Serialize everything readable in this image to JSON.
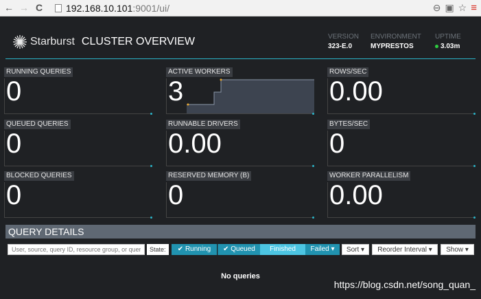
{
  "browser": {
    "back": "←",
    "forward": "→",
    "reload": "C",
    "url_host": "192.168.10.101",
    "url_rest": ":9001/ui/"
  },
  "header": {
    "logo_text": "Starburst",
    "title": "CLUSTER OVERVIEW",
    "version_label": "VERSION",
    "version_value": "323-E.0",
    "environment_label": "ENVIRONMENT",
    "environment_value": "MYPRESTOS",
    "uptime_label": "UPTIME",
    "uptime_value": "3.03m"
  },
  "cards": {
    "running_queries": {
      "label": "RUNNING QUERIES",
      "value": "0"
    },
    "active_workers": {
      "label": "ACTIVE WORKERS",
      "value": "3"
    },
    "rows_sec": {
      "label": "ROWS/SEC",
      "value": "0.00"
    },
    "queued_queries": {
      "label": "QUEUED QUERIES",
      "value": "0"
    },
    "runnable_drivers": {
      "label": "RUNNABLE DRIVERS",
      "value": "0.00"
    },
    "bytes_sec": {
      "label": "BYTES/SEC",
      "value": "0"
    },
    "blocked_queries": {
      "label": "BLOCKED QUERIES",
      "value": "0"
    },
    "reserved_memory": {
      "label": "RESERVED MEMORY (B)",
      "value": "0"
    },
    "worker_parallelism": {
      "label": "WORKER PARALLELISM",
      "value": "0.00"
    }
  },
  "query_details": {
    "title": "QUERY DETAILS",
    "search_placeholder": "User, source, query ID, resource group, or query text",
    "state_label": "State:",
    "running": "✔ Running",
    "queued": "✔ Queued",
    "finished": "Finished",
    "failed": "Failed ▾",
    "sort": "Sort ▾",
    "reorder": "Reorder Interval ▾",
    "show": "Show ▾",
    "empty": "No queries"
  },
  "watermark": "https://blog.csdn.net/song_quan_",
  "colors": {
    "accent": "#2ab3c7",
    "active_button": "#2193b0",
    "uptime": "#2ecc40"
  }
}
